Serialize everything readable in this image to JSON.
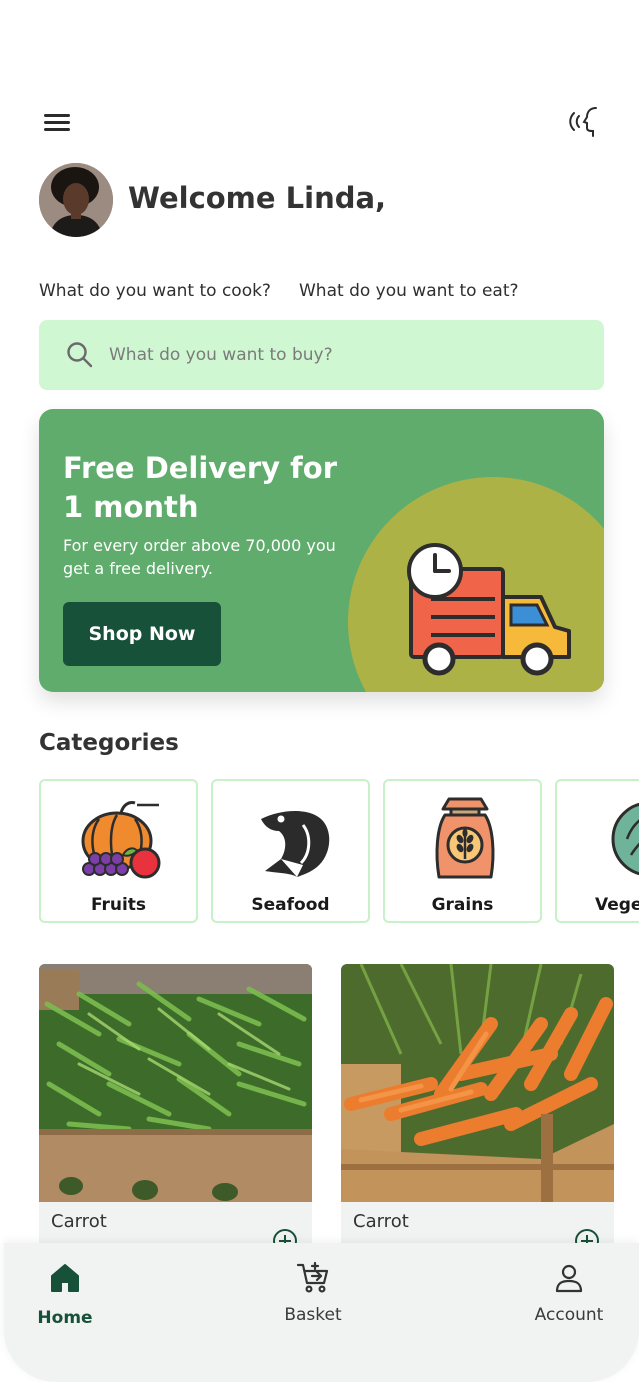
{
  "header": {
    "menu_icon": "hamburger-menu-icon",
    "voice_icon": "voice-assistant-icon",
    "welcome": "Welcome Linda,"
  },
  "prompts": {
    "cook": "What do you want to cook?",
    "eat": "What do you want to eat?"
  },
  "search": {
    "placeholder": "What do you want to buy?",
    "icon": "search-icon"
  },
  "promo": {
    "title": "Free Delivery for 1 month",
    "text": "For every order above 70,000 you get a free delivery.",
    "button": "Shop Now",
    "colors": {
      "background": "#5fac6c",
      "circle": "#adb246",
      "button": "#17513a"
    }
  },
  "categories": {
    "title": "Categories",
    "items": [
      {
        "label": "Fruits",
        "icon": "fruits-icon"
      },
      {
        "label": "Seafood",
        "icon": "fish-icon"
      },
      {
        "label": "Grains",
        "icon": "grain-sack-icon"
      },
      {
        "label": "Vege",
        "icon": "cabbage-icon"
      }
    ]
  },
  "products": [
    {
      "name": "Carrot",
      "image": "green-beans-crate"
    },
    {
      "name": "Carrot",
      "image": "carrots-crate"
    }
  ],
  "bottom_nav": {
    "items": [
      {
        "label": "Home",
        "icon": "home-icon",
        "active": true
      },
      {
        "label": "Basket",
        "icon": "basket-cart-icon",
        "active": false
      },
      {
        "label": "Account",
        "icon": "account-icon",
        "active": false
      }
    ],
    "active_color": "#17513a"
  }
}
